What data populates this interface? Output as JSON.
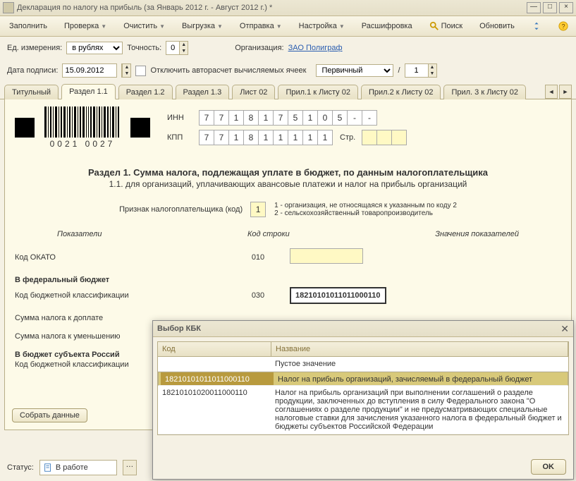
{
  "titlebar": {
    "title": "Декларация по налогу на прибыль (за Январь 2012 г. - Август 2012 г.) *"
  },
  "toolbar": {
    "fill": "Заполнить",
    "check": "Проверка",
    "clear": "Очистить",
    "export": "Выгрузка",
    "send": "Отправка",
    "settings": "Настройка",
    "decode": "Расшифровка",
    "search": "Поиск",
    "refresh": "Обновить"
  },
  "row1": {
    "unit_label": "Ед. измерения:",
    "unit_value": "в рублях",
    "prec_label": "Точность:",
    "prec_value": "0",
    "org_label": "Организация:",
    "org_link": "ЗАО Полиграф"
  },
  "row2": {
    "date_label": "Дата подписи:",
    "date_value": "15.09.2012",
    "auto_label": "Отключить авторасчет вычисляемых ячеек",
    "type_value": "Первичный",
    "slash": "/",
    "num": "1"
  },
  "tabs": {
    "t1": "Титульный",
    "t2": "Раздел 1.1",
    "t3": "Раздел 1.2",
    "t4": "Раздел 1.3",
    "t5": "Лист 02",
    "t6": "Прил.1 к Листу 02",
    "t7": "Прил.2 к Листу 02",
    "t8": "Прил. 3 к Листу 02"
  },
  "page": {
    "barcode_text": "0021 0027",
    "inn_label": "ИНН",
    "inn": [
      "7",
      "7",
      "1",
      "8",
      "1",
      "7",
      "5",
      "1",
      "0",
      "5",
      "-",
      "-"
    ],
    "kpp_label": "КПП",
    "kpp": [
      "7",
      "7",
      "1",
      "8",
      "1",
      "1",
      "1",
      "1",
      "1"
    ],
    "page_label": "Стр.",
    "section_title": "Раздел 1. Сумма налога, подлежащая уплате в бюджет, по данным налогоплательщика",
    "section_sub": "1.1. для организаций, уплачивающих авансовые платежи и налог на прибыль организаций",
    "sign_label": "Признак налогоплательщика (код)",
    "sign_code": "1",
    "sign_note1": "1 - организация, не относящаяся к указанным по коду 2",
    "sign_note2": "2 - сельскохозяйственный товаропроизводитель",
    "col1": "Показатели",
    "col2": "Код строки",
    "col3": "Значения показателей",
    "okato_label": "Код ОКАТО",
    "okato_code": "010",
    "fed_head": "В федеральный бюджет",
    "kbk_label": "Код бюджетной классификации",
    "kbk_code": "030",
    "kbk_value": "18210101011011000110",
    "tax_add": "Сумма налога к доплате",
    "tax_dec": "Сумма налога к уменьшению",
    "subj_head": "В бюджет субъекта Россий",
    "kbk2_label": "Код бюджетной классификации",
    "collect_btn": "Собрать данные",
    "status_label": "Статус:",
    "status_value": "В работе"
  },
  "modal": {
    "title": "Выбор КБК",
    "col1": "Код",
    "col2": "Название",
    "rows": [
      {
        "code": "",
        "name": "Пустое значение"
      },
      {
        "code": "18210101011011000110",
        "name": "Налог на прибыль организаций, зачисляемый в федеральный бюджет"
      },
      {
        "code": "18210101020011000110",
        "name": "Налог на прибыль организаций при выполнении соглашений о разделе продукции, заключенных до вступления в силу Федерального закона \"О соглашениях о разделе продукции\" и не предусматривающих специальные налоговые ставки для зачисления указанного налога в федеральный бюджет и бюджеты субъектов Российской Федерации"
      }
    ],
    "ok": "OK"
  }
}
